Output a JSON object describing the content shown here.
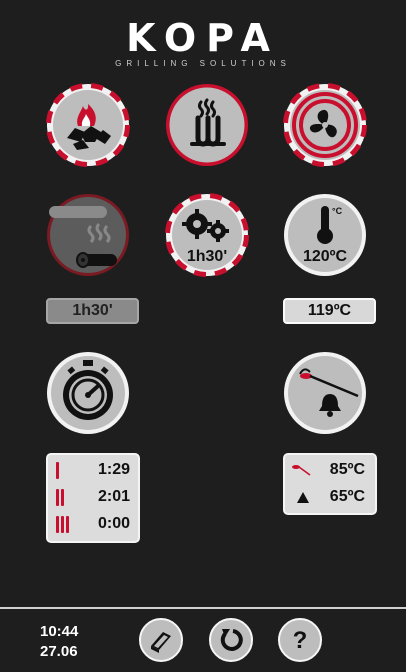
{
  "brand": {
    "logo": "KOPA",
    "tagline": "GRILLING SOLUTIONS"
  },
  "buttons": {
    "charcoal": {
      "icon": "charcoal-fire-icon"
    },
    "heater": {
      "icon": "heating-element-icon"
    },
    "fan": {
      "icon": "fan-icon"
    },
    "smoke": {
      "icon": "smoke-log-icon"
    },
    "program": {
      "icon": "gears-icon",
      "label": "1h30'"
    },
    "temperature": {
      "icon": "thermometer-icon",
      "label": "120ºC"
    }
  },
  "readouts": {
    "smoke_time": "1h30'",
    "current_temp": "119ºC"
  },
  "timers": {
    "icon": "stopwatch-icon",
    "rows": [
      {
        "value": "1:29"
      },
      {
        "value": "2:01"
      },
      {
        "value": "0:00"
      }
    ]
  },
  "probe": {
    "icon": "probe-bell-icon",
    "current": "85ºC",
    "target": "65ºC"
  },
  "status": {
    "time": "10:44",
    "date": "27.06"
  },
  "bottom_bar": [
    {
      "icon": "book-icon"
    },
    {
      "icon": "reset-icon"
    },
    {
      "icon": "help-icon",
      "label": "?"
    }
  ],
  "colors": {
    "background": "#1e1e1e",
    "accent": "#c8102e",
    "button": "#bdbdbd"
  }
}
